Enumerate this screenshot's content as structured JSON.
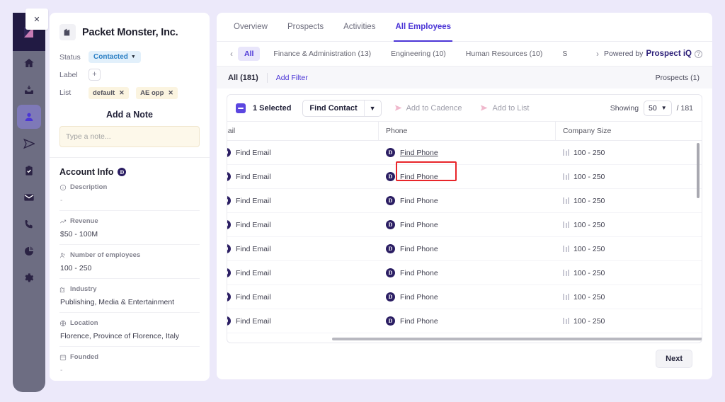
{
  "rail": {
    "close_label": "✕",
    "items": [
      {
        "name": "home-icon",
        "label": "Home"
      },
      {
        "name": "inbox-icon",
        "label": "Inbox"
      },
      {
        "name": "contacts-icon",
        "label": "Contacts"
      },
      {
        "name": "send-icon",
        "label": "Send"
      },
      {
        "name": "tasks-icon",
        "label": "Tasks"
      },
      {
        "name": "mail-icon",
        "label": "Mail"
      },
      {
        "name": "call-icon",
        "label": "Calls"
      },
      {
        "name": "reports-icon",
        "label": "Reports"
      },
      {
        "name": "settings-icon",
        "label": "Settings"
      }
    ]
  },
  "panel": {
    "company_name": "Packet Monster, Inc.",
    "status_label": "Status",
    "status_value": "Contacted",
    "label_label": "Label",
    "label_add": "+",
    "list_label": "List",
    "list_chips": [
      "default",
      "AE opp"
    ],
    "chip_remove": "✕",
    "note_title": "Add a Note",
    "note_placeholder": "Type a note...",
    "note_value": "",
    "account_info_title": "Account Info",
    "account_badge": "D",
    "fields": [
      {
        "label": "Description",
        "value": "-",
        "icon": "info-icon"
      },
      {
        "label": "Revenue",
        "value": "$50 - 100M",
        "icon": "trending-up-icon"
      },
      {
        "label": "Number of employees",
        "value": "100 - 250",
        "icon": "people-icon"
      },
      {
        "label": "Industry",
        "value": "Publishing, Media & Entertainment",
        "icon": "building-icon"
      },
      {
        "label": "Location",
        "value": "Florence, Province of Florence, Italy",
        "icon": "globe-icon"
      },
      {
        "label": "Founded",
        "value": "-",
        "icon": "calendar-icon"
      }
    ]
  },
  "main": {
    "tabs": [
      {
        "label": "Overview",
        "active": false
      },
      {
        "label": "Prospects",
        "active": false
      },
      {
        "label": "Activities",
        "active": false
      },
      {
        "label": "All Employees",
        "active": true
      }
    ],
    "dept_prev": "‹",
    "dept_next": "›",
    "departments": [
      {
        "label": "All",
        "active": true
      },
      {
        "label": "Finance & Administration (13)",
        "active": false
      },
      {
        "label": "Engineering (10)",
        "active": false
      },
      {
        "label": "Human Resources (10)",
        "active": false
      },
      {
        "label": "S",
        "active": false
      }
    ],
    "powered_by_prefix": "Powered by",
    "powered_by_brand": "Prospect iQ",
    "help_icon": "?",
    "all_count": "All  (181)",
    "add_filter": "Add Filter",
    "prospects_count": "Prospects (1)",
    "toolbar": {
      "selected_text": "1 Selected",
      "find_contact": "Find Contact",
      "find_contact_caret": "▼",
      "add_to_cadence": "Add to Cadence",
      "add_to_list": "Add to List",
      "showing_label": "Showing",
      "page_size": "50",
      "page_size_caret": "▼",
      "total_label": "/ 181"
    },
    "table": {
      "columns": [
        "mail",
        "Phone",
        "Company Size"
      ],
      "rows": [
        {
          "email": "Find Email",
          "phone": "Find Phone",
          "size": "100 - 250"
        },
        {
          "email": "Find Email",
          "phone": "Find Phone",
          "size": "100 - 250"
        },
        {
          "email": "Find Email",
          "phone": "Find Phone",
          "size": "100 - 250"
        },
        {
          "email": "Find Email",
          "phone": "Find Phone",
          "size": "100 - 250"
        },
        {
          "email": "Find Email",
          "phone": "Find Phone",
          "size": "100 - 250"
        },
        {
          "email": "Find Email",
          "phone": "Find Phone",
          "size": "100 - 250"
        },
        {
          "email": "Find Email",
          "phone": "Find Phone",
          "size": "100 - 250"
        },
        {
          "email": "Find Email",
          "phone": "Find Phone",
          "size": "100 - 250"
        }
      ],
      "row_badge": "D"
    },
    "next_button": "Next"
  },
  "colors": {
    "accent": "#4b35d6",
    "checkbox": "#5b46e0",
    "highlight": "#e8252a",
    "brand_dark": "#2b1e63",
    "page_bg": "#ece9fa"
  }
}
